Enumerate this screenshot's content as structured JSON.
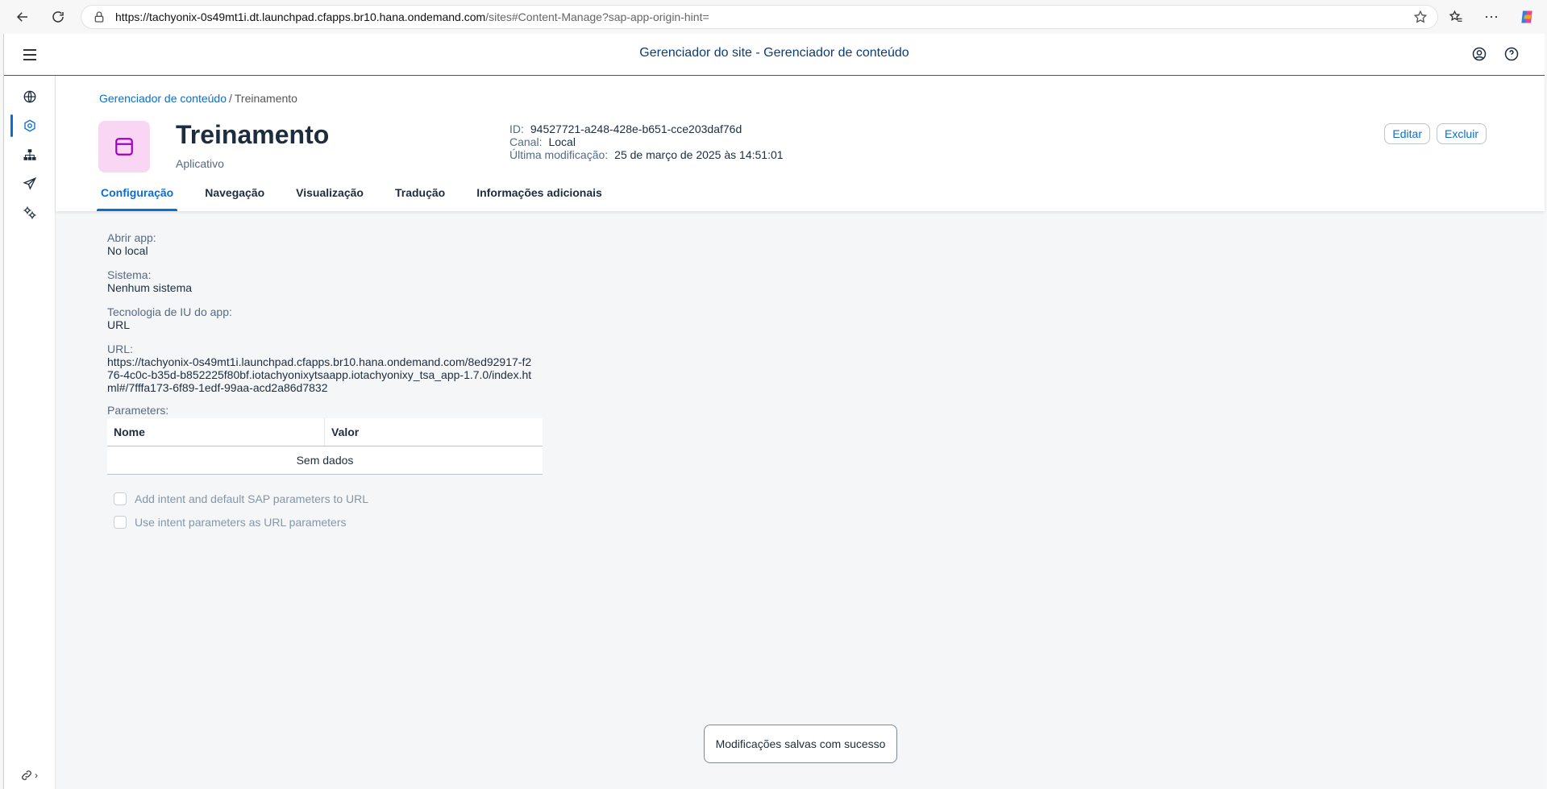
{
  "browser": {
    "url_host": "https://tachyonix-0s49mt1i.dt.launchpad.cfapps.br10.hana.ondemand.com",
    "url_path": "/sites#Content-Manage?sap-app-origin-hint="
  },
  "shell": {
    "title": "Gerenciador do site - Gerenciador de conteúdo"
  },
  "breadcrumb": {
    "parent": "Gerenciador de conteúdo",
    "separator": "/",
    "current": "Treinamento"
  },
  "object": {
    "title": "Treinamento",
    "subtitle": "Aplicativo",
    "id_label": "ID:",
    "id_value": "94527721-a248-428e-b651-cce203daf76d",
    "channel_label": "Canal:",
    "channel_value": "Local",
    "modified_label": "Última modificação:",
    "modified_value": "25 de março de 2025 às 14:51:01",
    "edit_label": "Editar",
    "delete_label": "Excluir"
  },
  "tabs": [
    {
      "label": "Configuração",
      "active": true
    },
    {
      "label": "Navegação",
      "active": false
    },
    {
      "label": "Visualização",
      "active": false
    },
    {
      "label": "Tradução",
      "active": false
    },
    {
      "label": "Informações adicionais",
      "active": false
    }
  ],
  "config": {
    "open_app_label": "Abrir app:",
    "open_app_value": "No local",
    "system_label": "Sistema:",
    "system_value": "Nenhum sistema",
    "ui_tech_label": "Tecnologia de IU do app:",
    "ui_tech_value": "URL",
    "url_label": "URL:",
    "url_value": "https://tachyonix-0s49mt1i.launchpad.cfapps.br10.hana.ondemand.com/8ed92917-f276-4c0c-b35d-b852225f80bf.iotachyonixytsaapp.iotachyonixy_tsa_app-1.7.0/index.html#/7fffa173-6f89-1edf-99aa-acd2a86d7832",
    "params_label": "Parameters:",
    "col_name": "Nome",
    "col_value": "Valor",
    "no_data": "Sem dados",
    "check1_label": "Add intent and default SAP parameters to URL",
    "check2_label": "Use intent parameters as URL parameters"
  },
  "toast": {
    "message": "Modificações salvas com sucesso"
  },
  "colors": {
    "accent": "#0a6ed1",
    "tile_bg": "#f9d6f3",
    "tile_icon": "#a100c2"
  }
}
